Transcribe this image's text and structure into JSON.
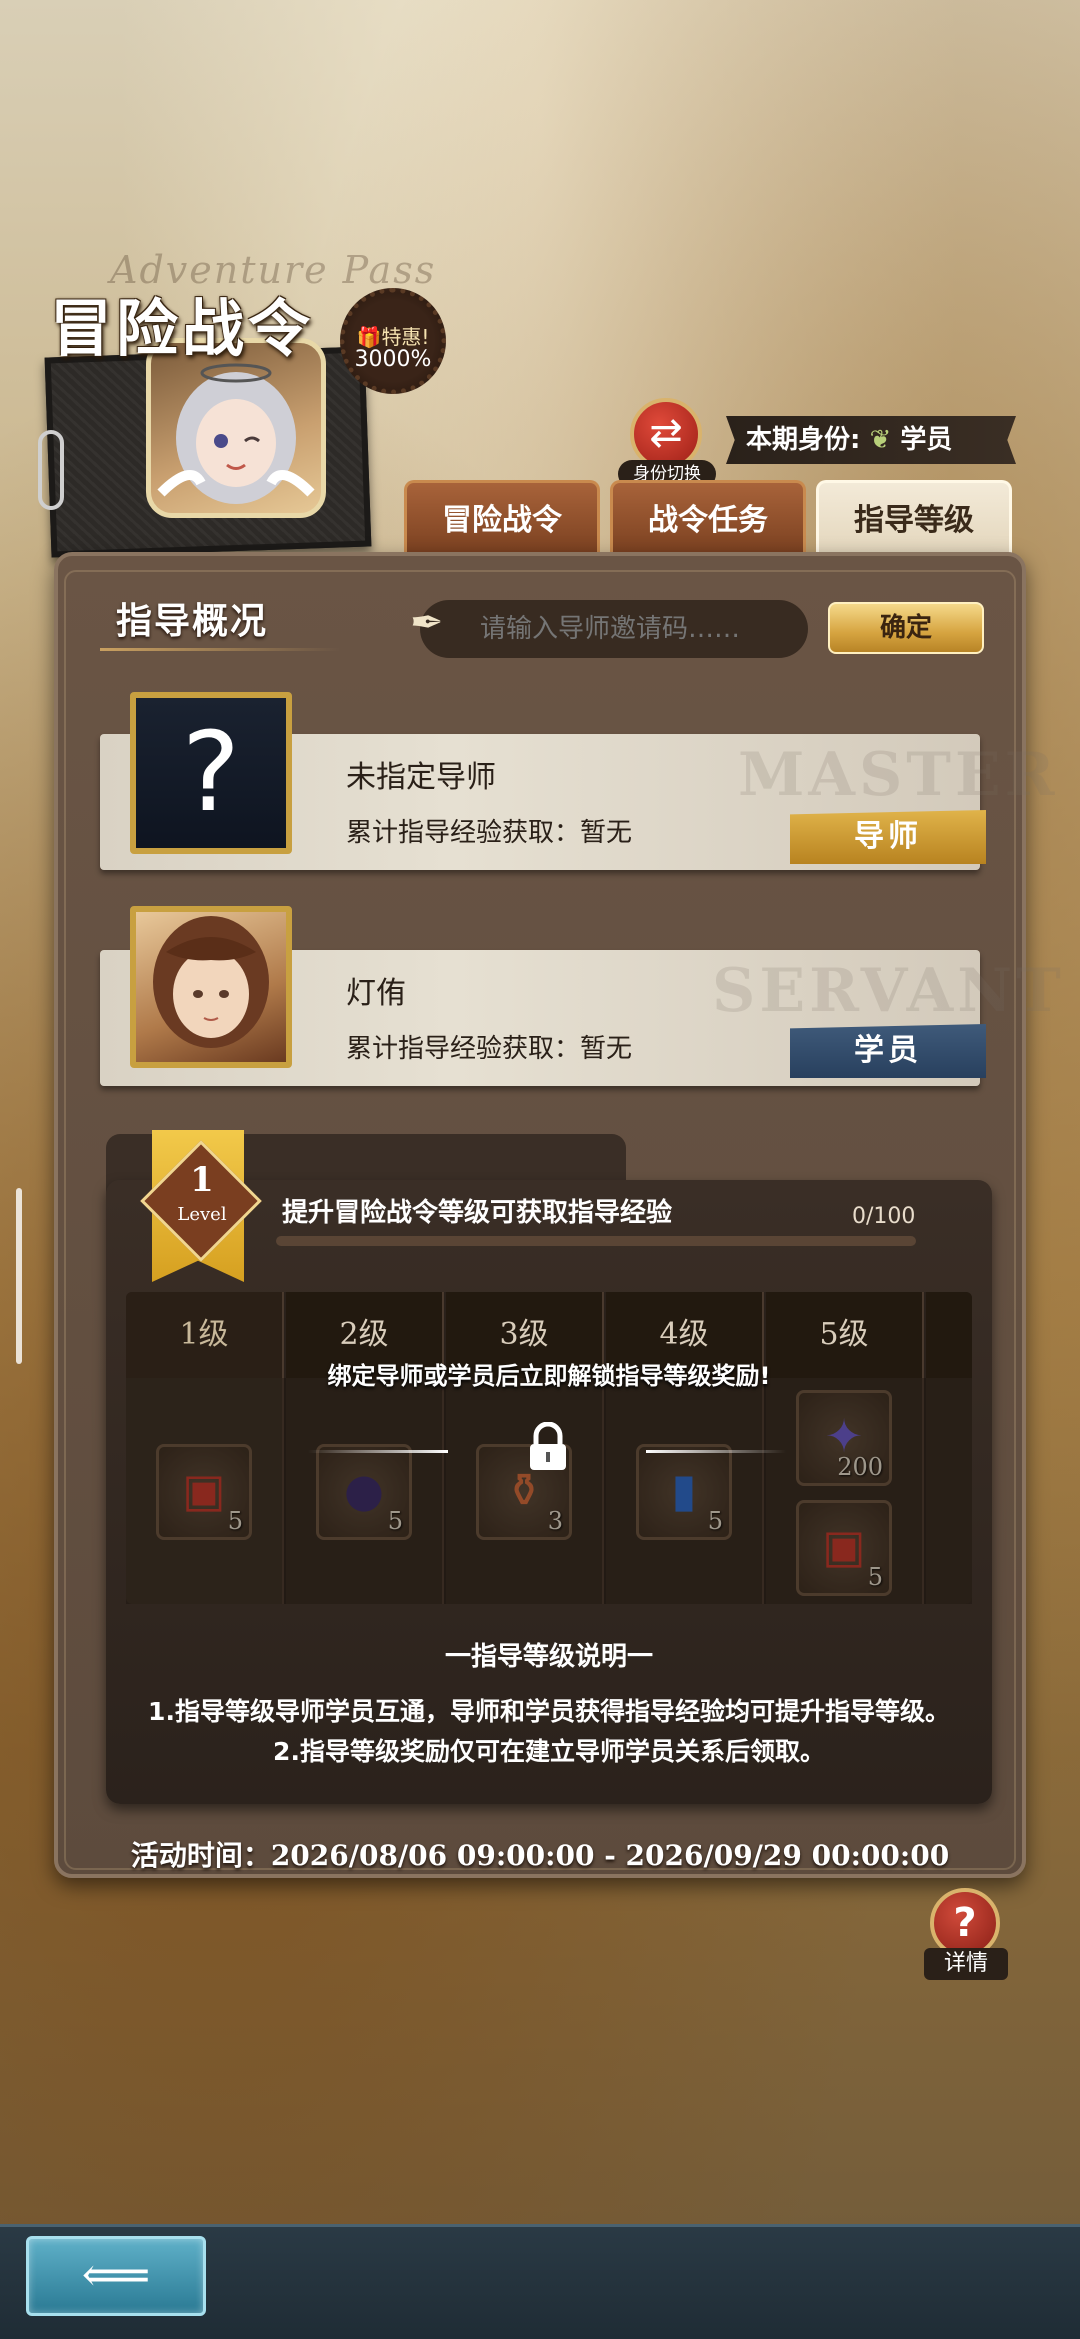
{
  "header": {
    "title": "冒险战令",
    "script_text": "Adventure Pass",
    "badge_top": "特惠!",
    "badge_bottom": "3000%"
  },
  "identity": {
    "switch_label": "身份切换",
    "current_label": "本期身份:",
    "current_value": "学员"
  },
  "tabs": [
    {
      "label": "冒险战令",
      "active": false
    },
    {
      "label": "战令任务",
      "active": false
    },
    {
      "label": "指导等级",
      "active": true
    }
  ],
  "overview": {
    "title": "指导概况",
    "invite_placeholder": "请输入导师邀请码……",
    "confirm_label": "确定"
  },
  "mentor_card": {
    "name": "未指定导师",
    "exp_text": "累计指导经验获取：暂无",
    "bg_word": "MASTER",
    "role_tag": "导师"
  },
  "student_card": {
    "name": "灯侑",
    "exp_text": "累计指导经验获取：暂无",
    "bg_word": "SERVANT",
    "role_tag": "学员"
  },
  "level": {
    "number": "1",
    "word": "Level",
    "description": "提升冒险战令等级可获取指导经验",
    "progress_text": "0/100",
    "progress_fraction": 0.0,
    "lock_message": "绑定导师或学员后立即解锁指导等级奖励!",
    "columns": [
      {
        "label": "1级",
        "items": [
          {
            "icon": "treasure-chest-icon",
            "glyph": "▣",
            "color": "#c8362a",
            "count": "5"
          }
        ]
      },
      {
        "label": "2级",
        "items": [
          {
            "icon": "dark-orb-icon",
            "glyph": "●",
            "color": "#3a2a6a",
            "count": "5"
          }
        ]
      },
      {
        "label": "3级",
        "items": [
          {
            "icon": "potion-bottle-icon",
            "glyph": "⚱",
            "color": "#d86a3a",
            "count": "3"
          }
        ]
      },
      {
        "label": "4级",
        "items": [
          {
            "icon": "blue-vial-icon",
            "glyph": "▮",
            "color": "#2a6ad0",
            "count": "5"
          }
        ]
      },
      {
        "label": "5级",
        "items": [
          {
            "icon": "star-crystal-icon",
            "glyph": "✦",
            "color": "#6a5ad0",
            "count": "200"
          },
          {
            "icon": "treasure-chest-icon",
            "glyph": "▣",
            "color": "#c8362a",
            "count": "5"
          }
        ]
      }
    ]
  },
  "rules": {
    "title": "一指导等级说明一",
    "lines": [
      "1.指导等级导师学员互通，导师和学员获得指导经验均可提升指导等级。",
      "2.指导等级奖励仅可在建立导师学员关系后领取。"
    ]
  },
  "activity_time": "活动时间：2026/08/06 09:00:00 - 2026/09/29 00:00:00",
  "detail_label": "详情",
  "colors": {
    "gold": "#d6a440",
    "panel": "#5d4b3d",
    "tab_inactive": "#a8633a",
    "tab_active": "#f3ead8",
    "mentor_tag": "#b88320",
    "student_tag": "#28405e"
  }
}
